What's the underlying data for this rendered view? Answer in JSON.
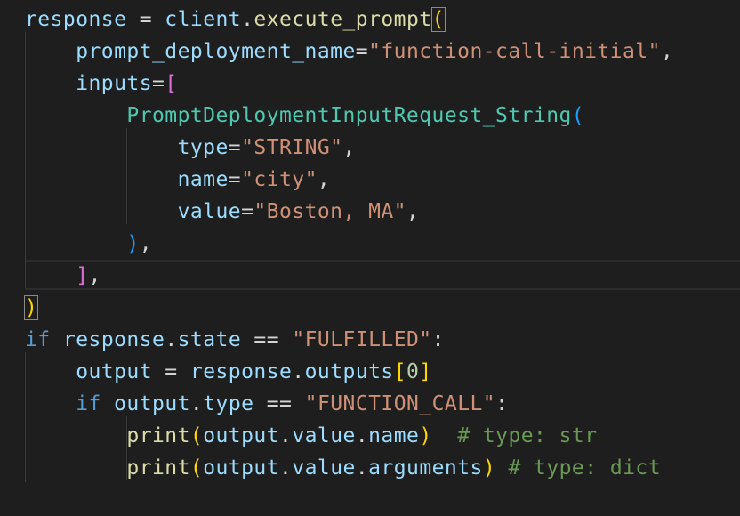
{
  "code_lines": [
    [
      {
        "t": "response",
        "c": "v"
      },
      {
        "t": " = ",
        "c": "o"
      },
      {
        "t": "client",
        "c": "v"
      },
      {
        "t": ".",
        "c": "o"
      },
      {
        "t": "execute_prompt",
        "c": "f"
      },
      {
        "t": "(",
        "c": "b1",
        "hl": true
      }
    ],
    [
      {
        "t": "    "
      },
      {
        "t": "prompt_deployment_name",
        "c": "v"
      },
      {
        "t": "=",
        "c": "o"
      },
      {
        "t": "\"function-call-initial\"",
        "c": "s"
      },
      {
        "t": ",",
        "c": "o"
      }
    ],
    [
      {
        "t": "    "
      },
      {
        "t": "inputs",
        "c": "v"
      },
      {
        "t": "=",
        "c": "o"
      },
      {
        "t": "[",
        "c": "b2"
      }
    ],
    [
      {
        "t": "        "
      },
      {
        "t": "PromptDeploymentInputRequest_String",
        "c": "cl"
      },
      {
        "t": "(",
        "c": "b3"
      }
    ],
    [
      {
        "t": "            "
      },
      {
        "t": "type",
        "c": "v"
      },
      {
        "t": "=",
        "c": "o"
      },
      {
        "t": "\"STRING\"",
        "c": "s"
      },
      {
        "t": ",",
        "c": "o"
      }
    ],
    [
      {
        "t": "            "
      },
      {
        "t": "name",
        "c": "v"
      },
      {
        "t": "=",
        "c": "o"
      },
      {
        "t": "\"city\"",
        "c": "s"
      },
      {
        "t": ",",
        "c": "o"
      }
    ],
    [
      {
        "t": "            "
      },
      {
        "t": "value",
        "c": "v"
      },
      {
        "t": "=",
        "c": "o"
      },
      {
        "t": "\"Boston, MA\"",
        "c": "s"
      },
      {
        "t": ",",
        "c": "o"
      }
    ],
    [
      {
        "t": "        "
      },
      {
        "t": ")",
        "c": "b3"
      },
      {
        "t": ",",
        "c": "o"
      }
    ],
    [
      {
        "t": "    "
      },
      {
        "t": "]",
        "c": "b2"
      },
      {
        "t": ",",
        "c": "o"
      }
    ],
    [
      {
        "t": ")",
        "c": "b1",
        "hl": true
      }
    ],
    [
      {
        "t": "if",
        "c": "k"
      },
      {
        "t": " "
      },
      {
        "t": "response",
        "c": "v"
      },
      {
        "t": ".",
        "c": "o"
      },
      {
        "t": "state",
        "c": "v"
      },
      {
        "t": " == ",
        "c": "o"
      },
      {
        "t": "\"FULFILLED\"",
        "c": "s"
      },
      {
        "t": ":",
        "c": "o"
      }
    ],
    [
      {
        "t": "    "
      },
      {
        "t": "output",
        "c": "v"
      },
      {
        "t": " = ",
        "c": "o"
      },
      {
        "t": "response",
        "c": "v"
      },
      {
        "t": ".",
        "c": "o"
      },
      {
        "t": "outputs",
        "c": "v"
      },
      {
        "t": "[",
        "c": "b1"
      },
      {
        "t": "0",
        "c": "n"
      },
      {
        "t": "]",
        "c": "b1"
      }
    ],
    [
      {
        "t": "    "
      },
      {
        "t": "if",
        "c": "k"
      },
      {
        "t": " "
      },
      {
        "t": "output",
        "c": "v"
      },
      {
        "t": ".",
        "c": "o"
      },
      {
        "t": "type",
        "c": "v"
      },
      {
        "t": " == ",
        "c": "o"
      },
      {
        "t": "\"FUNCTION_CALL\"",
        "c": "s"
      },
      {
        "t": ":",
        "c": "o"
      }
    ],
    [
      {
        "t": "        "
      },
      {
        "t": "print",
        "c": "f"
      },
      {
        "t": "(",
        "c": "b1"
      },
      {
        "t": "output",
        "c": "v"
      },
      {
        "t": ".",
        "c": "o"
      },
      {
        "t": "value",
        "c": "v"
      },
      {
        "t": ".",
        "c": "o"
      },
      {
        "t": "name",
        "c": "v"
      },
      {
        "t": ")",
        "c": "b1"
      },
      {
        "t": "  "
      },
      {
        "t": "# type: str",
        "c": "c"
      }
    ],
    [
      {
        "t": "        "
      },
      {
        "t": "print",
        "c": "f"
      },
      {
        "t": "(",
        "c": "b1"
      },
      {
        "t": "output",
        "c": "v"
      },
      {
        "t": ".",
        "c": "o"
      },
      {
        "t": "value",
        "c": "v"
      },
      {
        "t": ".",
        "c": "o"
      },
      {
        "t": "arguments",
        "c": "v"
      },
      {
        "t": ")",
        "c": "b1"
      },
      {
        "t": " "
      },
      {
        "t": "# type: dict",
        "c": "c"
      }
    ]
  ]
}
